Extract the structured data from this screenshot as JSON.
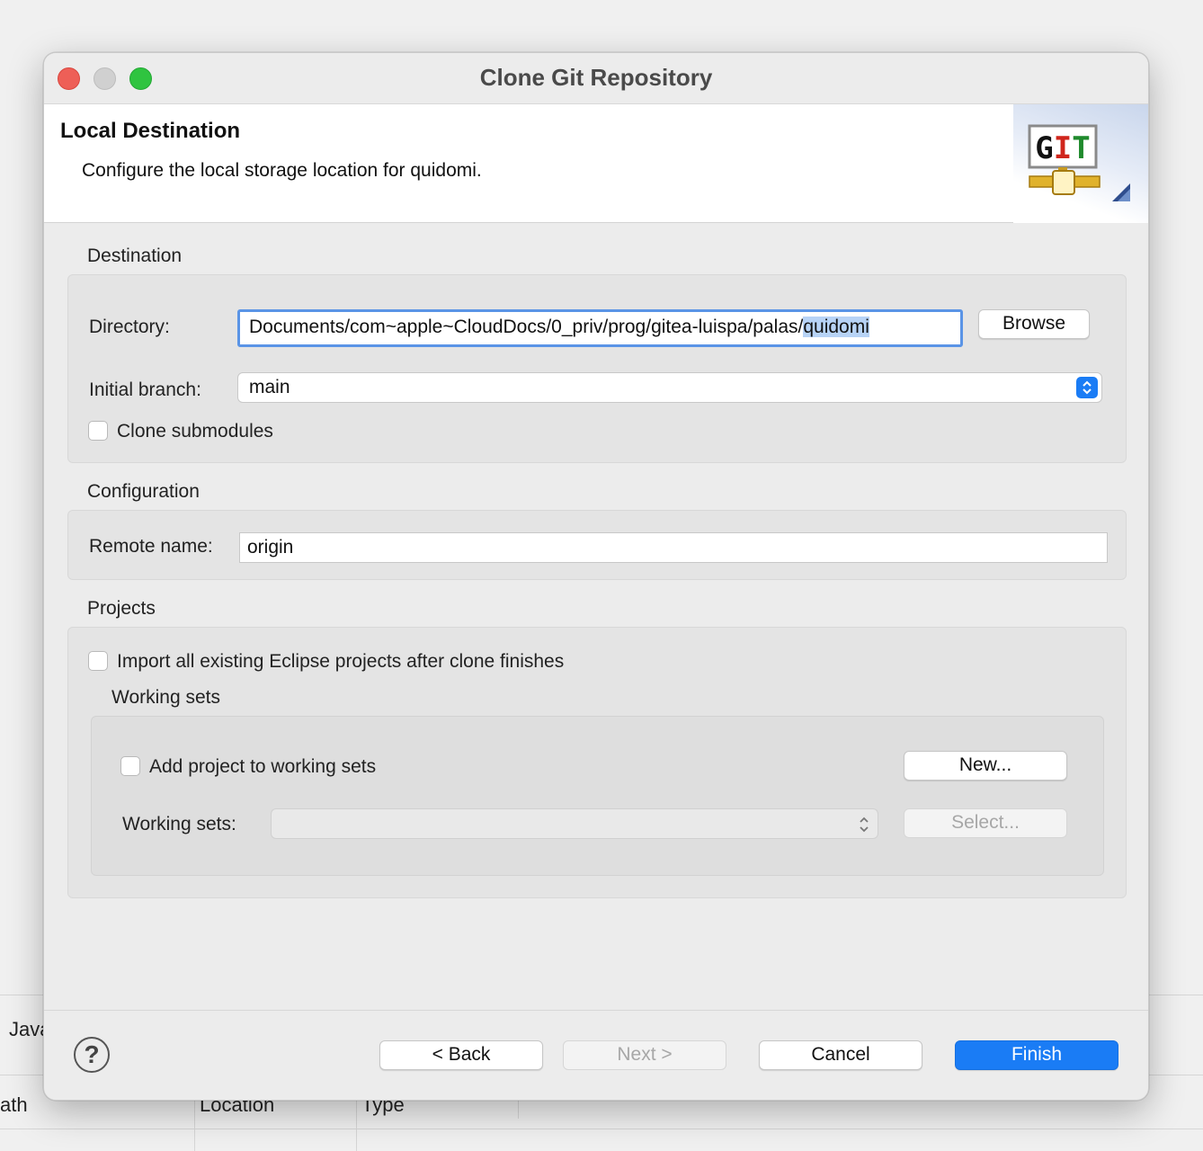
{
  "background": {
    "tab_fragment": "Java",
    "col_path": "ath",
    "col_location": "Location",
    "col_type": "Type"
  },
  "window": {
    "title": "Clone Git Repository"
  },
  "header": {
    "title": "Local Destination",
    "description": "Configure the local storage location for quidomi.",
    "logo_text": "GIT"
  },
  "destination": {
    "section_label": "Destination",
    "directory_label": "Directory:",
    "directory_prefix": "Documents/com~apple~CloudDocs/0_priv/prog/gitea-luispa/palas/",
    "directory_selected": "quidomi",
    "browse_label": "Browse",
    "branch_label": "Initial branch:",
    "branch_value": "main",
    "clone_submodules_label": "Clone submodules",
    "clone_submodules_checked": false
  },
  "configuration": {
    "section_label": "Configuration",
    "remote_label": "Remote name:",
    "remote_value": "origin"
  },
  "projects": {
    "section_label": "Projects",
    "import_label": "Import all existing Eclipse projects after clone finishes",
    "import_checked": false,
    "working_sets_group_label": "Working sets",
    "add_to_sets_label": "Add project to working sets",
    "add_to_sets_checked": false,
    "new_button": "New...",
    "working_sets_label": "Working sets:",
    "working_sets_value": "",
    "select_button": "Select..."
  },
  "footer": {
    "help_symbol": "?",
    "back": "< Back",
    "next": "Next >",
    "cancel": "Cancel",
    "finish": "Finish"
  }
}
